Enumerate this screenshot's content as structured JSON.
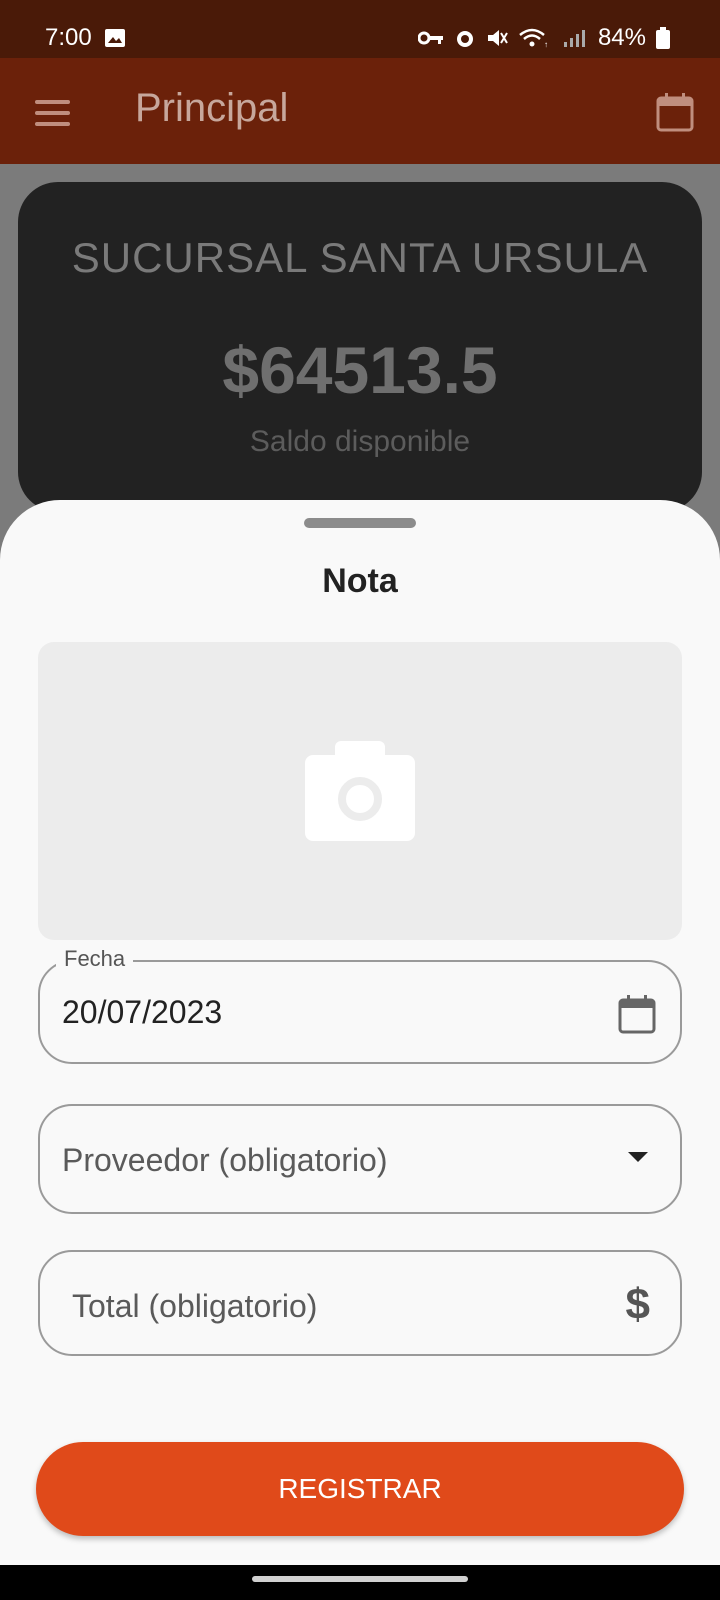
{
  "status_bar": {
    "time": "7:00",
    "battery": "84%",
    "icons": [
      "image-icon",
      "key-icon",
      "alarm-icon",
      "mute-icon",
      "wifi-icon",
      "signal-icon",
      "battery-icon"
    ]
  },
  "app_bar": {
    "title": "Principal",
    "menu_icon": "menu-icon",
    "calendar_icon": "calendar-icon"
  },
  "balance_card": {
    "branch": "SUCURSAL SANTA URSULA",
    "amount": "$64513.5",
    "label": "Saldo disponible"
  },
  "sheet": {
    "title": "Nota",
    "photo_icon": "camera-icon",
    "fecha": {
      "label": "Fecha",
      "value": "20/07/2023"
    },
    "proveedor": {
      "placeholder": "Proveedor (obligatorio)"
    },
    "total": {
      "placeholder": "Total (obligatorio)",
      "suffix": "$"
    },
    "submit_label": "REGISTRAR"
  },
  "colors": {
    "status_bar": "#4a1a08",
    "app_bar": "#6b210a",
    "accent": "#e04a1a",
    "sheet_bg": "#f9f9f9"
  }
}
